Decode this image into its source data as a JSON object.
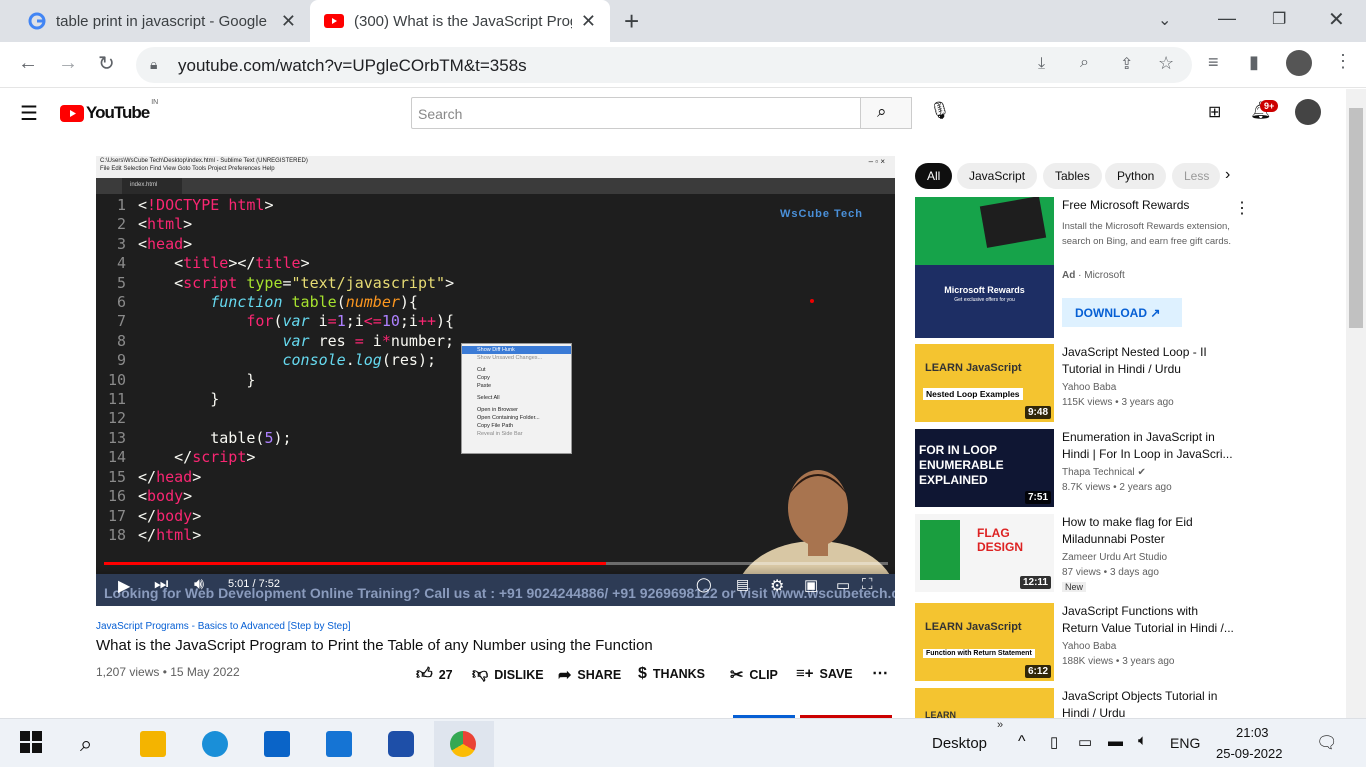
{
  "browser": {
    "tabs": [
      {
        "title": "table print in javascript - Google",
        "active": false
      },
      {
        "title": "(300) What is the JavaScript Prog",
        "active": true
      }
    ],
    "new_tab": "+",
    "url": "youtube.com/watch?v=UPgleCOrbTM&t=358s"
  },
  "youtube": {
    "logo": "YouTube",
    "region": "IN",
    "search_placeholder": "Search",
    "notification_count": "9+"
  },
  "video": {
    "editor_title": "C:\\Users\\WsCube Tech\\Desktop\\index.html - Sublime Text (UNREGISTERED)",
    "editor_menu": "File  Edit  Selection  Find  View  Goto  Tools  Project  Preferences  Help",
    "editor_tab": "index.html",
    "watermark": "WsCube Tech",
    "code_lines": [
      "1",
      "2",
      "3",
      "4",
      "5",
      "6",
      "7",
      "8",
      "9",
      "10",
      "11",
      "12",
      "13",
      "14",
      "15",
      "16",
      "17",
      "18"
    ],
    "context_menu": [
      "Show Diff Hunk",
      "Show Unsaved Changes...",
      "Cut",
      "Copy",
      "Paste",
      "Select All",
      "Open in Browser",
      "Open Containing Folder...",
      "Copy File Path",
      "Reveal in Side Bar"
    ],
    "ticker": "Looking for Web Development Online Training? Call us at : +91 9024244886/ +91 9269698122 or visit www.wscubetech.com",
    "time": "5:01 / 7:52",
    "progress": 0.64
  },
  "details": {
    "series": "JavaScript Programs - Basics to Advanced [Step by Step]",
    "title": "What is the JavaScript Program to Print the Table of any Number using the Function",
    "meta": "1,207 views • 15 May 2022",
    "likes": "27",
    "dislike": "DISLIKE",
    "share": "SHARE",
    "thanks": "THANKS",
    "clip": "CLIP",
    "save": "SAVE"
  },
  "chips": [
    "All",
    "JavaScript",
    "Tables",
    "Python",
    "Less"
  ],
  "ad": {
    "title": "Free Microsoft Rewards",
    "desc": "Install the Microsoft Rewards extension, search on Bing, and earn free gift cards.",
    "label": "Ad",
    "advertiser": "Microsoft",
    "cta": "DOWNLOAD",
    "banner": "Microsoft Rewards",
    "banner_sub": "Get exclusive offers for you"
  },
  "related": [
    {
      "title": "JavaScript Nested Loop - II Tutorial in Hindi / Urdu",
      "channel": "Yahoo Baba",
      "stats": "115K views • 3 years ago",
      "duration": "9:48",
      "thumb_text": "Nested Loop Examples"
    },
    {
      "title": "Enumeration in JavaScript in Hindi | For In Loop in JavaScri...",
      "channel": "Thapa Technical",
      "stats": "8.7K views • 2 years ago",
      "duration": "7:51",
      "thumb_text": "FOR IN LOOP ENUMERABLE EXPLAINED"
    },
    {
      "title": "How to make flag for Eid Miladunnabi Poster",
      "channel": "Zameer Urdu Art Studio",
      "stats": "87 views • 3 days ago",
      "badge": "New",
      "duration": "12:11",
      "thumb_text": "FLAG DESIGN"
    },
    {
      "title": "JavaScript Functions with Return Value Tutorial in Hindi /...",
      "channel": "Yahoo Baba",
      "stats": "188K views • 3 years ago",
      "duration": "6:12",
      "thumb_text": "Function with Return Statement"
    },
    {
      "title": "JavaScript Objects Tutorial in Hindi / Urdu",
      "channel": "",
      "stats": "",
      "duration": "",
      "thumb_text": "LEARN"
    }
  ],
  "taskbar": {
    "desktop_label": "Desktop",
    "lang": "ENG",
    "time": "21:03",
    "date": "25-09-2022"
  }
}
